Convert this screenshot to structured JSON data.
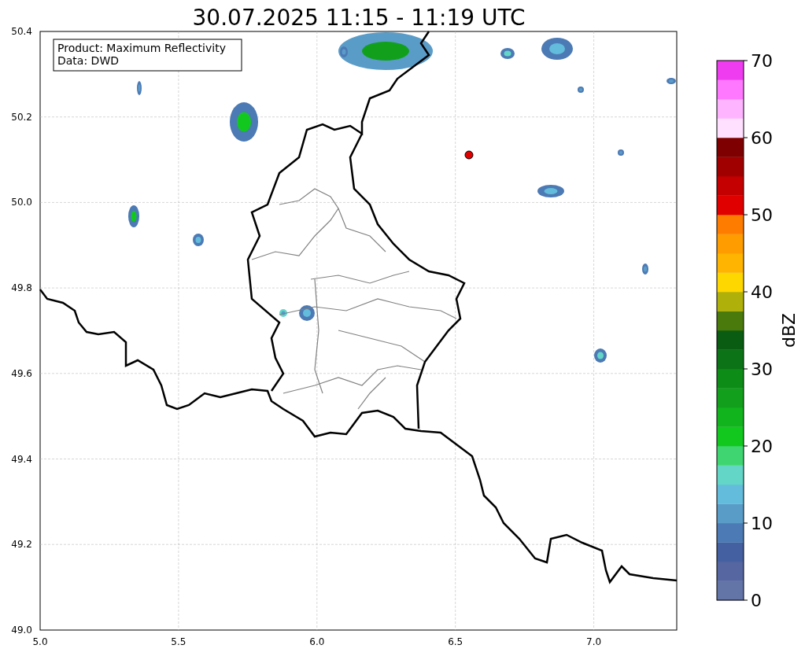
{
  "title": "30.07.2025 11:15 - 11:19 UTC",
  "info_box": [
    "Product: Maximum Reflectivity",
    "Data: DWD"
  ],
  "map": {
    "x_ticks": [
      "5.0",
      "5.5",
      "6.0",
      "6.5",
      "7.0"
    ],
    "y_ticks": [
      "50.4",
      "50.2",
      "50.0",
      "49.8",
      "49.6",
      "49.4",
      "49.2",
      "49.0"
    ]
  },
  "colorbar": {
    "label": "dBZ",
    "ticks": [
      "70",
      "60",
      "50",
      "40",
      "30",
      "20",
      "10",
      "0"
    ],
    "segments": [
      {
        "color": "#6374a6"
      },
      {
        "color": "#5566a0"
      },
      {
        "color": "#4560a0"
      },
      {
        "color": "#4c7ab4"
      },
      {
        "color": "#5a9cc8"
      },
      {
        "color": "#63bcdc"
      },
      {
        "color": "#63d6c8"
      },
      {
        "color": "#3fd672"
      },
      {
        "color": "#12c81e"
      },
      {
        "color": "#12b41e"
      },
      {
        "color": "#12a01c"
      },
      {
        "color": "#0e8c18"
      },
      {
        "color": "#0c7416"
      },
      {
        "color": "#0a5c12"
      },
      {
        "color": "#4a7a0c"
      },
      {
        "color": "#b0b00a"
      },
      {
        "color": "#fed700"
      },
      {
        "color": "#feb400"
      },
      {
        "color": "#fe9c00"
      },
      {
        "color": "#fe7d00"
      },
      {
        "color": "#e00000"
      },
      {
        "color": "#c40000"
      },
      {
        "color": "#a00000"
      },
      {
        "color": "#7e0000"
      },
      {
        "color": "#ffe0ff"
      },
      {
        "color": "#ffb4ff"
      },
      {
        "color": "#ff78ff"
      },
      {
        "color": "#f03cf0"
      }
    ]
  }
}
